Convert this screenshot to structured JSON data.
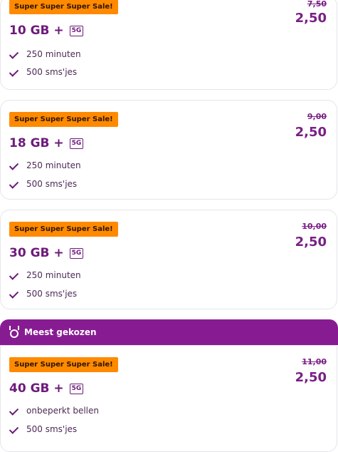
{
  "plans": [
    {
      "badge": "Super Super Super Sale!",
      "old_price": "7,50",
      "price": "2,50",
      "title": "10 GB +",
      "network": "5G",
      "features": [
        "250 minuten",
        "500 sms'jes"
      ]
    },
    {
      "badge": "Super Super Super Sale!",
      "old_price": "9,00",
      "price": "2,50",
      "title": "18 GB +",
      "network": "5G",
      "features": [
        "250 minuten",
        "500 sms'jes"
      ]
    },
    {
      "badge": "Super Super Super Sale!",
      "old_price": "10,00",
      "price": "2,50",
      "title": "30 GB +",
      "network": "5G",
      "features": [
        "250 minuten",
        "500 sms'jes"
      ]
    },
    {
      "badge": "Super Super Super Sale!",
      "old_price": "11,00",
      "price": "2,50",
      "title": "40 GB +",
      "network": "5G",
      "features": [
        "onbeperkt bellen",
        "500 sms'jes"
      ]
    }
  ],
  "popular_banner": {
    "label": "Meest gekozen",
    "icon": "medal-icon"
  },
  "colors": {
    "brand_purple": "#871c92",
    "text_purple": "#6d1a7b",
    "sale_orange": "#ff8a00"
  }
}
